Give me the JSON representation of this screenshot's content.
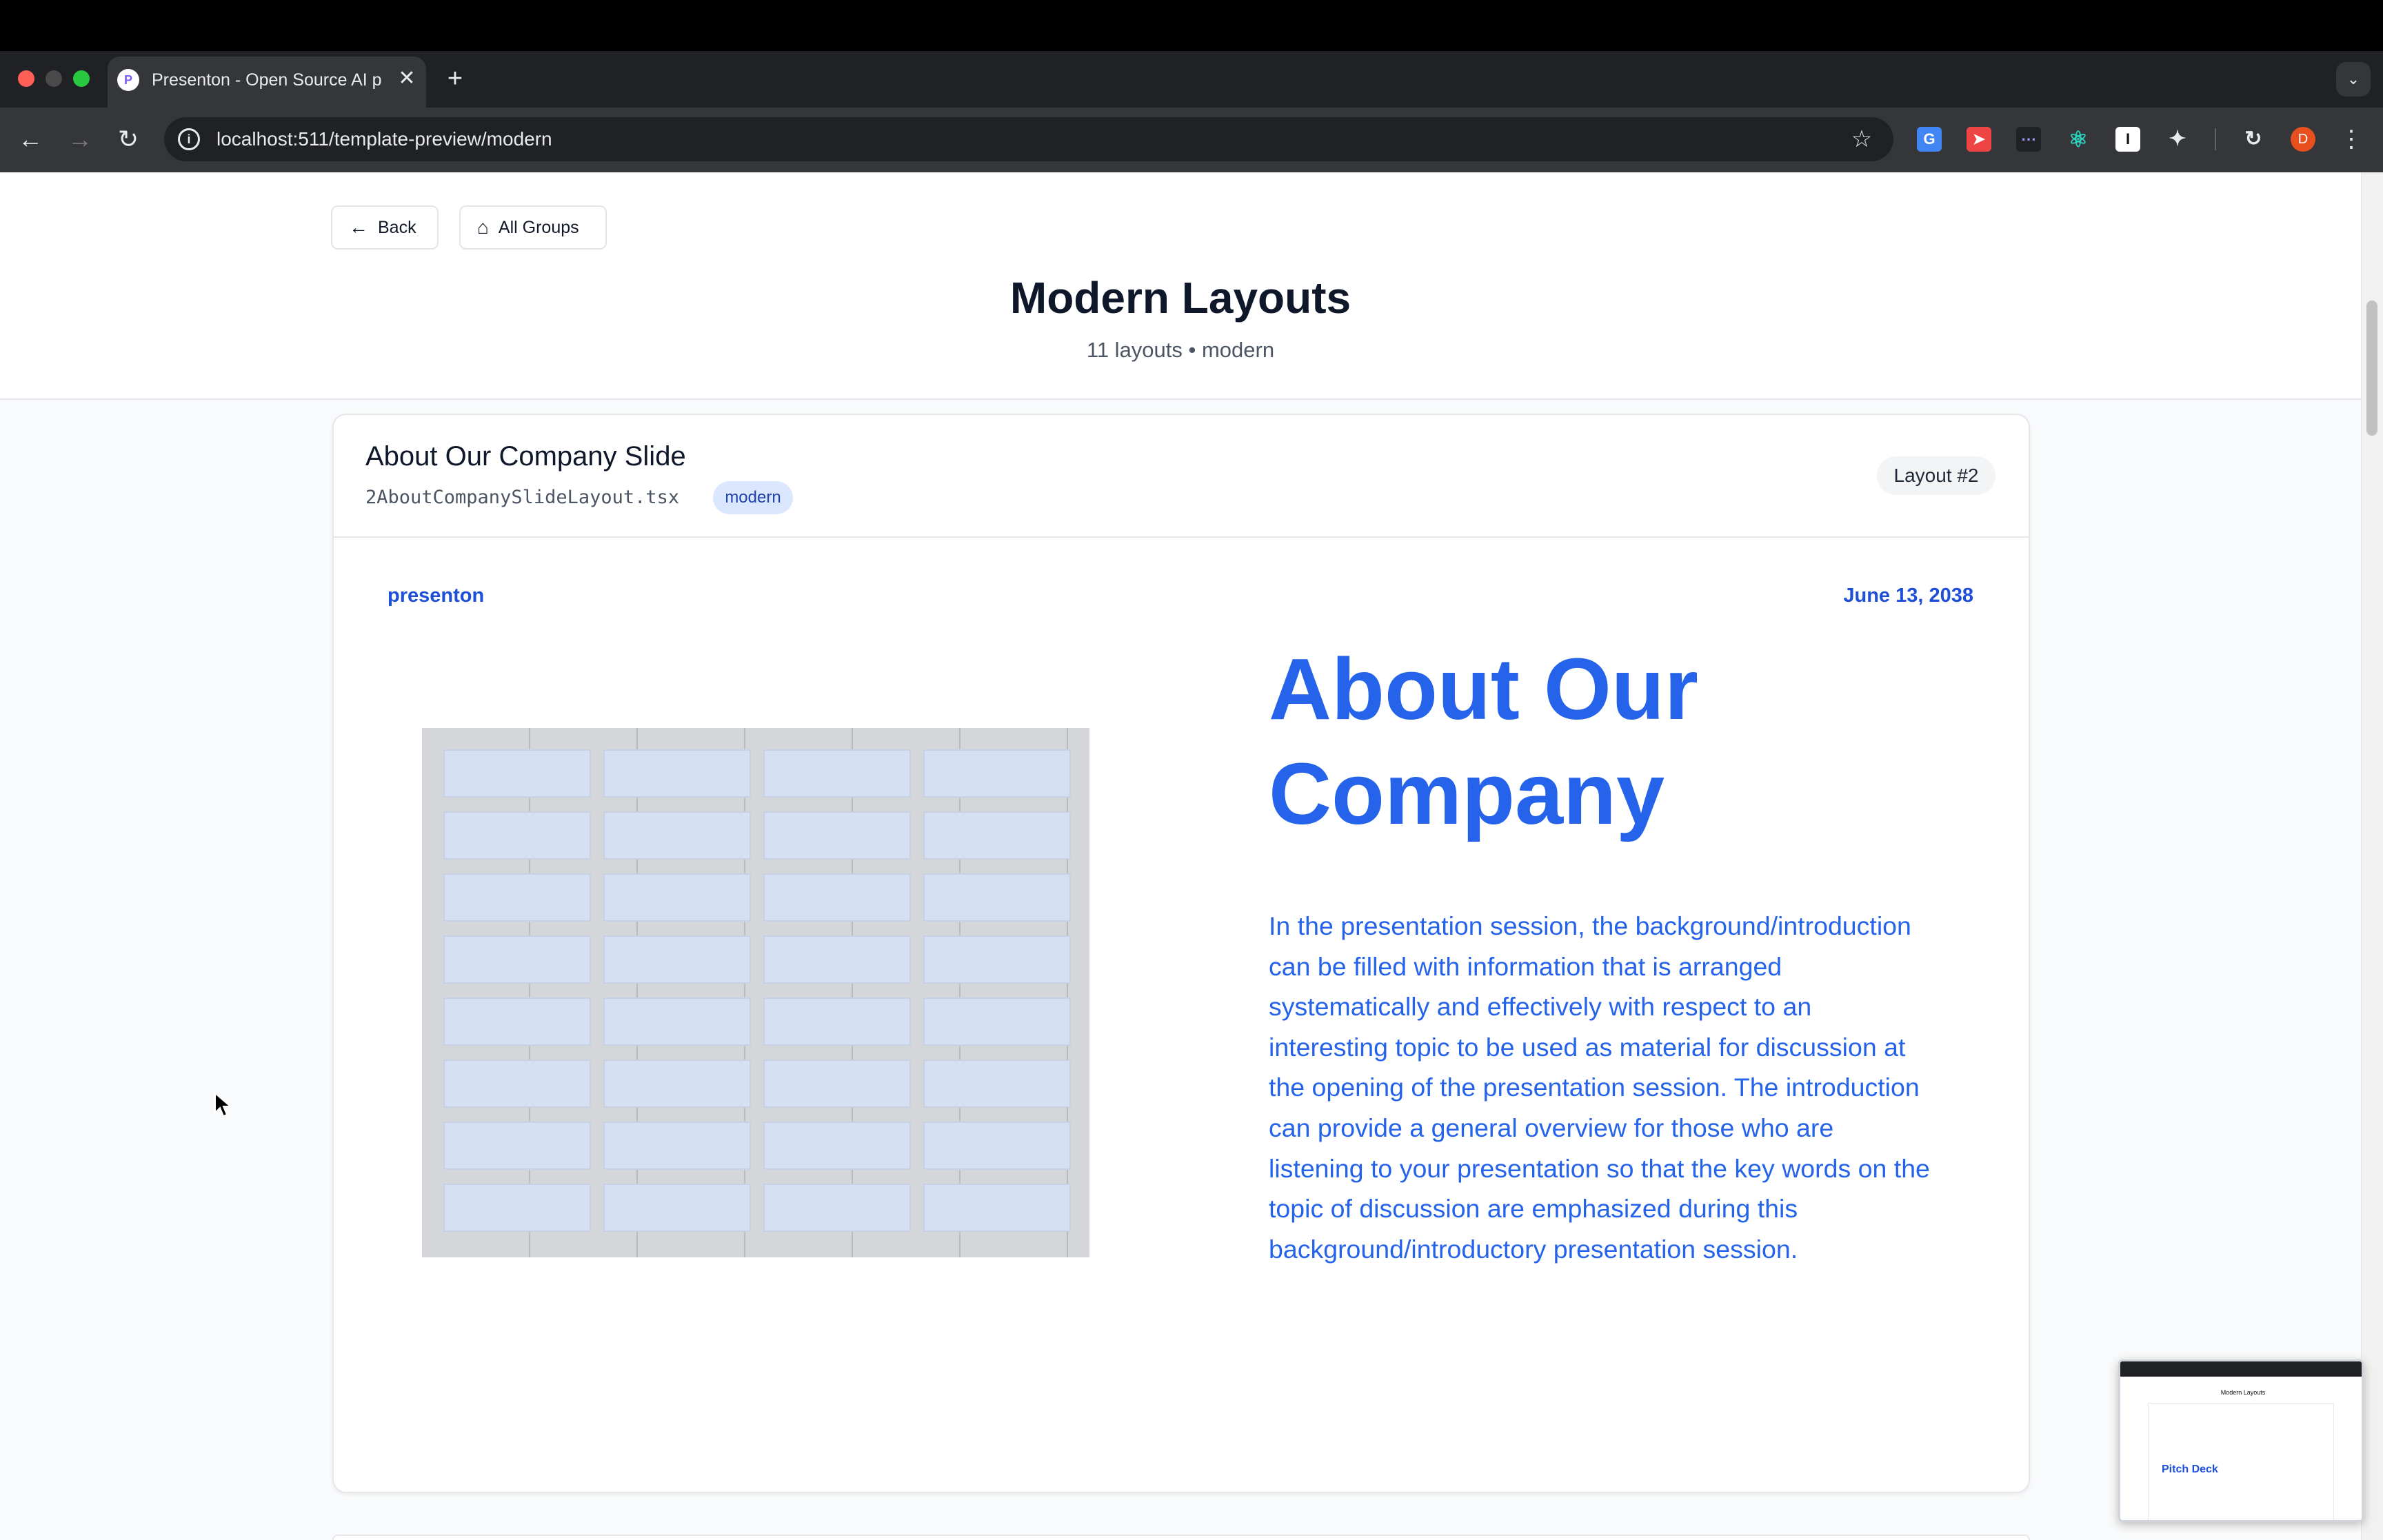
{
  "browser": {
    "tab_title": "Presenton - Open Source AI p",
    "tab_favicon": "P",
    "tab_close": "✕",
    "new_tab": "+",
    "url": "localhost:511/template-preview/modern",
    "avatar_letter": "D",
    "icons": [
      "back-icon",
      "forward-icon",
      "reload-icon",
      "info-icon",
      "star-icon",
      "translate-icon",
      "rocket-icon",
      "dots-icon",
      "react-icon",
      "i-icon",
      "puzzle-icon",
      "gauge-icon",
      "menu-icon",
      "tab-search-icon"
    ]
  },
  "toolbar": {
    "back_label": "Back",
    "groups_label": "All Groups"
  },
  "header": {
    "title": "Modern Layouts",
    "subtitle": "11 layouts • modern"
  },
  "layout_card": {
    "title": "About Our Company Slide",
    "file_name": "2AboutCompanySlideLayout.tsx",
    "tag": "modern",
    "badge": "Layout #2"
  },
  "slide": {
    "brand": "presenton",
    "date": "June 13, 2038",
    "heading_line1": "About Our",
    "heading_line2": "Company",
    "body": "In the presentation session, the background/introduction can be filled with information that is arranged systematically and effectively with respect to an interesting topic to be used as material for discussion at the opening of the presentation session. The introduction can provide a general overview for those who are listening to your presentation so that the key words on the topic of discussion are emphasized during this background/introductory presentation session.",
    "image_alt": "office-building-facade-image"
  },
  "pip": {
    "title": "Modern Layouts",
    "text": "Pitch Deck"
  },
  "colors": {
    "accent": "#2563eb",
    "brand_text": "#1e4fd8",
    "tag_bg": "#dbe7fe"
  }
}
